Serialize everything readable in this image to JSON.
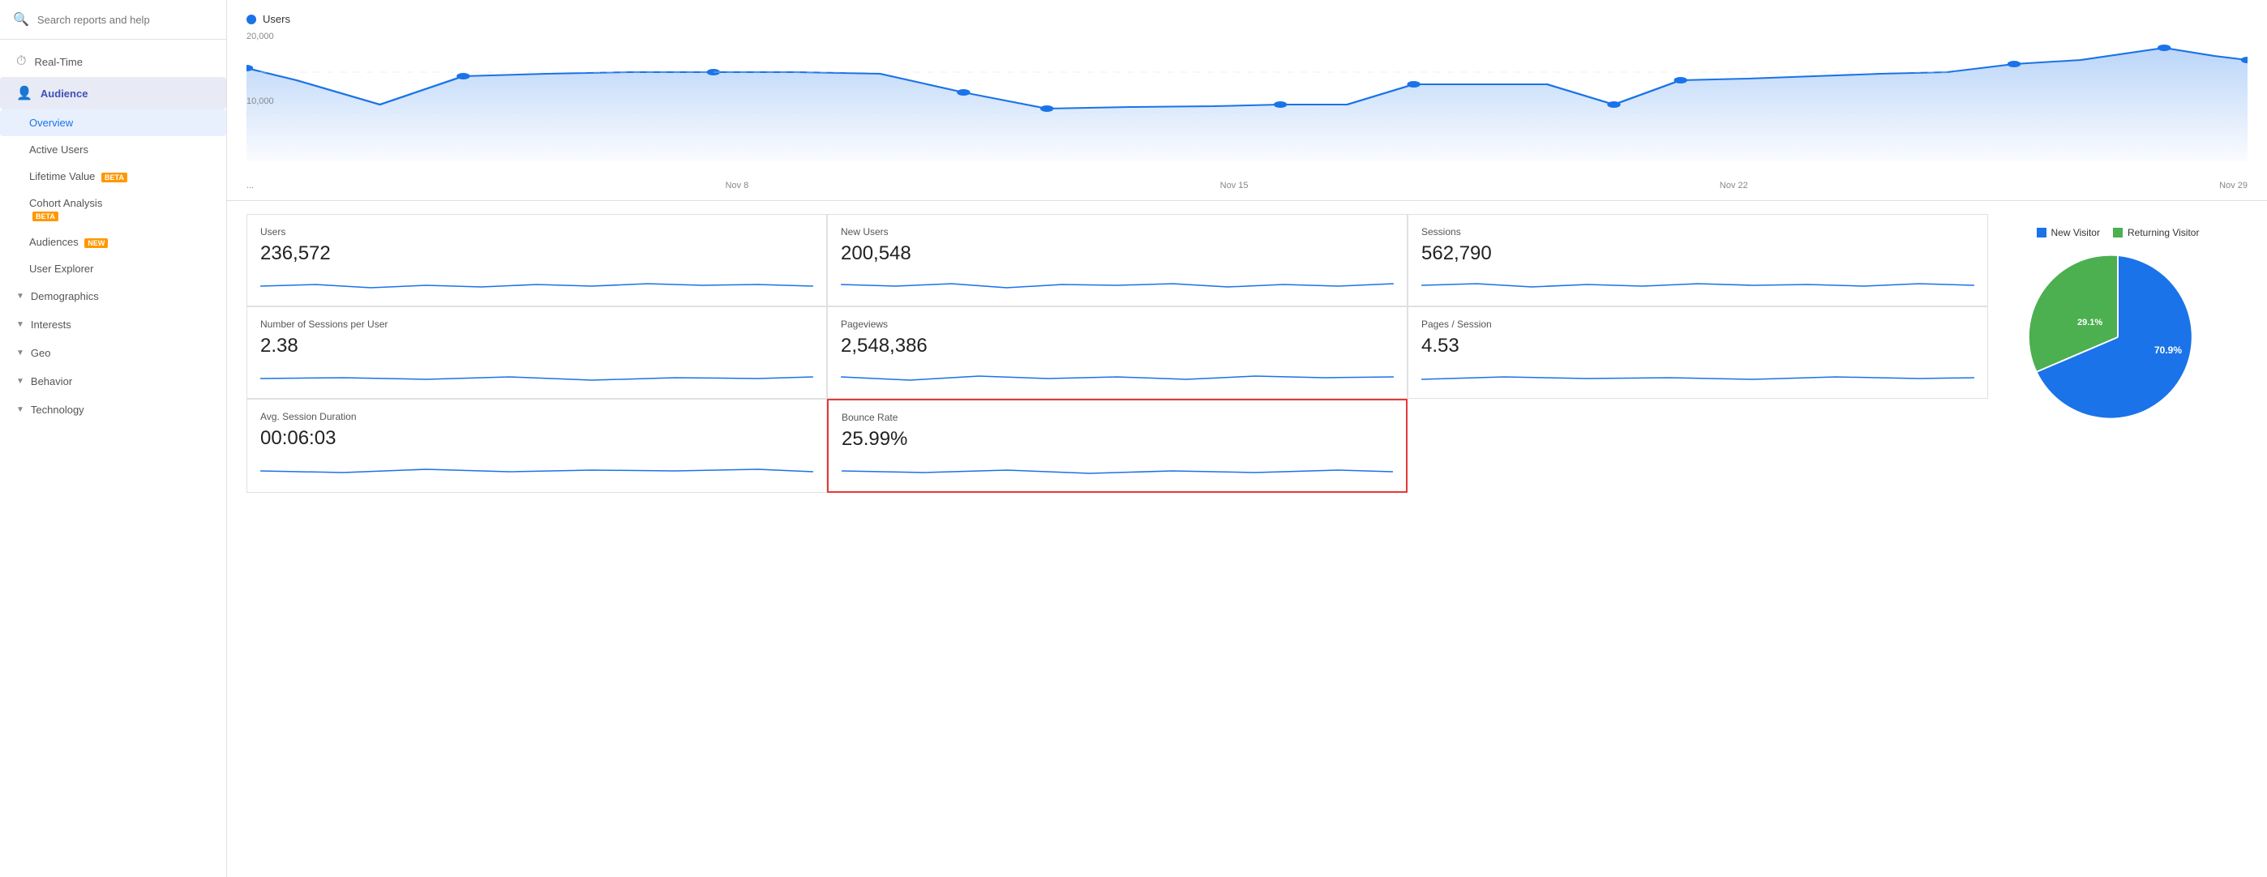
{
  "sidebar": {
    "search_placeholder": "Search reports and help",
    "nav_items": [
      {
        "id": "realtime",
        "label": "Real-Time",
        "icon": "⏱"
      },
      {
        "id": "audience",
        "label": "Audience",
        "icon": "👤",
        "active": true
      }
    ],
    "audience_sub": [
      {
        "id": "overview",
        "label": "Overview",
        "active": true
      },
      {
        "id": "active-users",
        "label": "Active Users",
        "active": false
      },
      {
        "id": "lifetime-value",
        "label": "Lifetime Value",
        "badge": "BETA",
        "badge_type": "beta"
      },
      {
        "id": "cohort-analysis",
        "label": "Cohort Analysis",
        "badge": "BETA",
        "badge_type": "beta"
      },
      {
        "id": "audiences",
        "label": "Audiences",
        "badge": "NEW",
        "badge_type": "new"
      },
      {
        "id": "user-explorer",
        "label": "User Explorer"
      }
    ],
    "collapsible_items": [
      {
        "id": "demographics",
        "label": "Demographics"
      },
      {
        "id": "interests",
        "label": "Interests"
      },
      {
        "id": "geo",
        "label": "Geo"
      },
      {
        "id": "behavior",
        "label": "Behavior"
      },
      {
        "id": "technology",
        "label": "Technology"
      }
    ]
  },
  "chart": {
    "legend_label": "Users",
    "y_labels": [
      "20,000",
      "10,000"
    ],
    "x_labels": [
      "...",
      "Nov 8",
      "Nov 15",
      "Nov 22",
      "Nov 29"
    ]
  },
  "metrics": [
    {
      "id": "users",
      "label": "Users",
      "value": "236,572",
      "highlighted": false
    },
    {
      "id": "new-users",
      "label": "New Users",
      "value": "200,548",
      "highlighted": false
    },
    {
      "id": "sessions",
      "label": "Sessions",
      "value": "562,790",
      "highlighted": false
    },
    {
      "id": "sessions-per-user",
      "label": "Number of Sessions per User",
      "value": "2.38",
      "highlighted": false
    },
    {
      "id": "pageviews",
      "label": "Pageviews",
      "value": "2,548,386",
      "highlighted": false
    },
    {
      "id": "pages-per-session",
      "label": "Pages / Session",
      "value": "4.53",
      "highlighted": false
    },
    {
      "id": "avg-session-duration",
      "label": "Avg. Session Duration",
      "value": "00:06:03",
      "highlighted": false
    },
    {
      "id": "bounce-rate",
      "label": "Bounce Rate",
      "value": "25.99%",
      "highlighted": true
    }
  ],
  "pie": {
    "new_visitor_label": "New Visitor",
    "returning_visitor_label": "Returning Visitor",
    "new_visitor_pct": "70.9%",
    "returning_visitor_pct": "29.1%",
    "new_visitor_color": "#1a73e8",
    "returning_visitor_color": "#4caf50",
    "new_visitor_value": 70.9,
    "returning_visitor_value": 29.1
  }
}
